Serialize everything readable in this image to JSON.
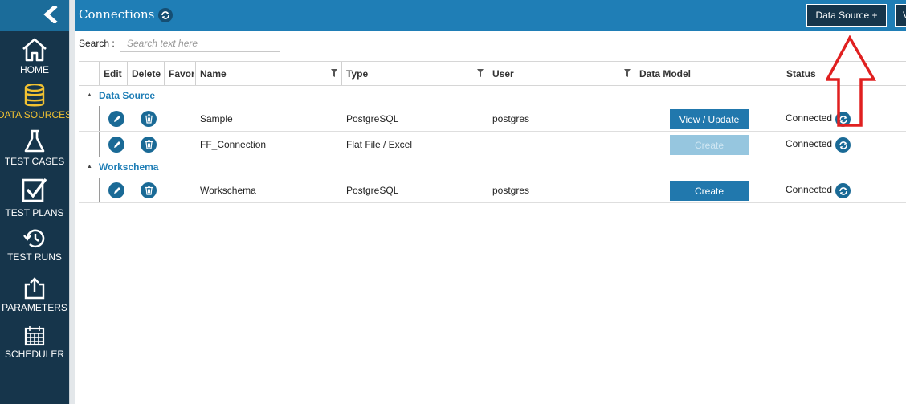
{
  "sidebar": {
    "collapse_icon": "chevron-left-icon",
    "items": [
      {
        "label": "HOME",
        "icon": "home-icon",
        "active": false
      },
      {
        "label": "DATA SOURCES",
        "icon": "database-icon",
        "active": true
      },
      {
        "label": "TEST CASES",
        "icon": "flask-icon",
        "active": false
      },
      {
        "label": "TEST PLANS",
        "icon": "checkbox-icon",
        "active": false
      },
      {
        "label": "TEST RUNS",
        "icon": "history-icon",
        "active": false
      },
      {
        "label": "PARAMETERS",
        "icon": "export-icon",
        "active": false
      },
      {
        "label": "SCHEDULER",
        "icon": "calendar-icon",
        "active": false
      }
    ]
  },
  "header": {
    "title": "Connections",
    "data_source_button": "Data Source +",
    "second_button": "V"
  },
  "search": {
    "label": "Search :",
    "placeholder": "Search text here",
    "value": ""
  },
  "grid": {
    "columns": [
      "Edit",
      "Delete",
      "Favorite",
      "Name",
      "Type",
      "User",
      "Data Model",
      "Status"
    ],
    "groups": [
      {
        "title": "Data Source",
        "rows": [
          {
            "name": "Sample",
            "type": "PostgreSQL",
            "user": "postgres",
            "data_model": "View / Update",
            "data_model_enabled": true,
            "status": "Connected"
          },
          {
            "name": "FF_Connection",
            "type": "Flat File / Excel",
            "user": "",
            "data_model": "Create",
            "data_model_enabled": false,
            "status": "Connected"
          }
        ]
      },
      {
        "title": "Workschema",
        "rows": [
          {
            "name": "Workschema",
            "type": "PostgreSQL",
            "user": "postgres",
            "data_model": "Create",
            "data_model_enabled": true,
            "status": "Connected"
          }
        ]
      }
    ]
  },
  "colors": {
    "sidebar_bg": "#16354b",
    "header_bg": "#1f7eb6",
    "active_nav": "#f1c232",
    "group_title": "#1f7eb6",
    "annotation_arrow": "#e02020"
  }
}
